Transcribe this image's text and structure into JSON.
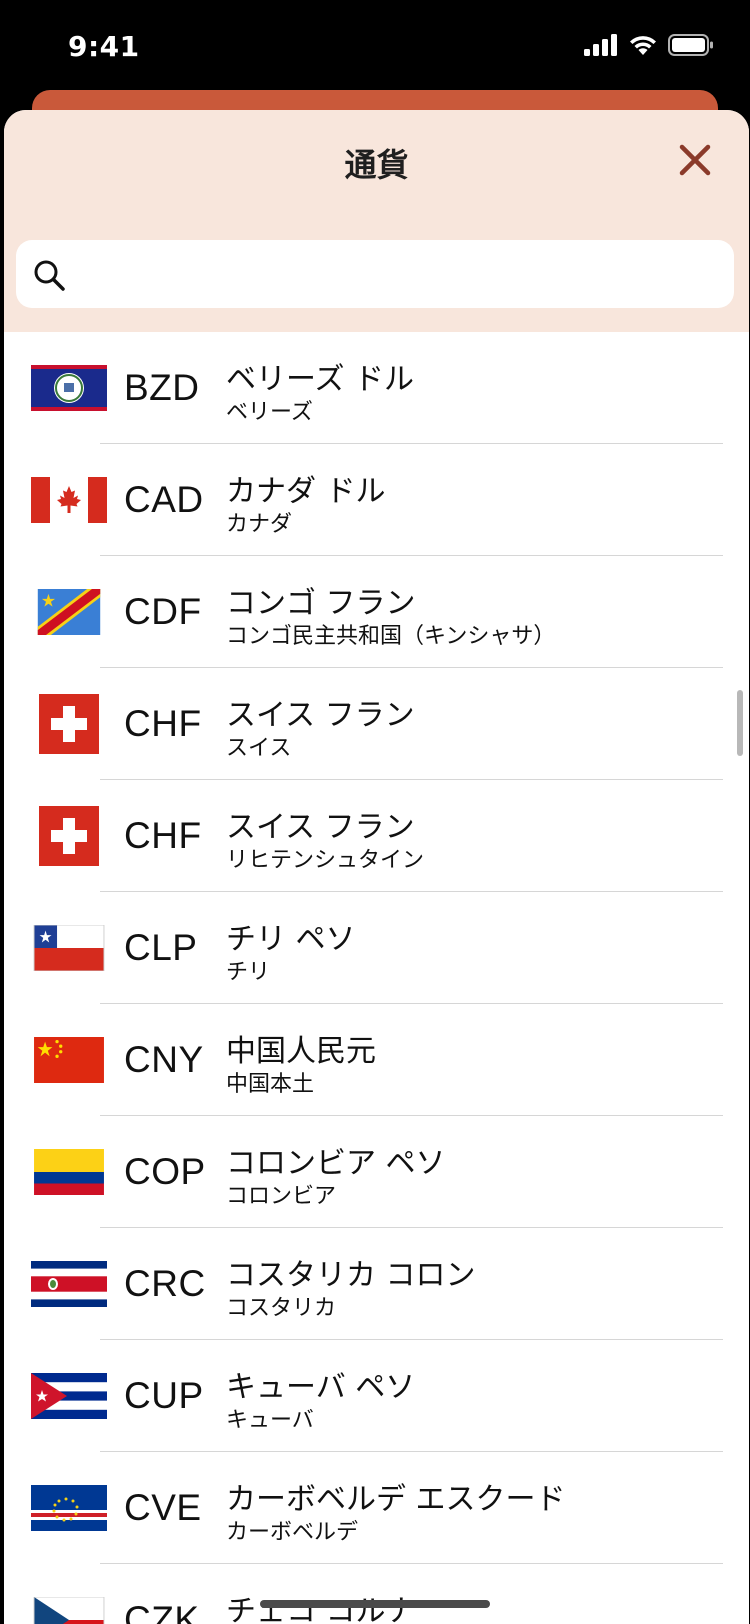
{
  "status_bar": {
    "time": "9:41",
    "icons": [
      "signal-icon",
      "wifi-icon",
      "battery-icon"
    ]
  },
  "sheet": {
    "title": "通貨",
    "close_icon": "close-icon",
    "search": {
      "placeholder": "",
      "value": ""
    }
  },
  "colors": {
    "accent": "#c9593a",
    "header_bg": "#f8e6dc",
    "close": "#8b3a2a"
  },
  "currencies": [
    {
      "code": "BZD",
      "name": "ベリーズ ドル",
      "region": "ベリーズ",
      "flag": "belize-flag"
    },
    {
      "code": "CAD",
      "name": "カナダ ドル",
      "region": "カナダ",
      "flag": "canada-flag"
    },
    {
      "code": "CDF",
      "name": "コンゴ フラン",
      "region": "コンゴ民主共和国（キンシャサ）",
      "flag": "dr-congo-flag"
    },
    {
      "code": "CHF",
      "name": "スイス フラン",
      "region": "スイス",
      "flag": "switzerland-flag"
    },
    {
      "code": "CHF",
      "name": "スイス フラン",
      "region": "リヒテンシュタイン",
      "flag": "switzerland-flag"
    },
    {
      "code": "CLP",
      "name": "チリ ペソ",
      "region": "チリ",
      "flag": "chile-flag"
    },
    {
      "code": "CNY",
      "name": "中国人民元",
      "region": "中国本土",
      "flag": "china-flag"
    },
    {
      "code": "COP",
      "name": "コロンビア ペソ",
      "region": "コロンビア",
      "flag": "colombia-flag"
    },
    {
      "code": "CRC",
      "name": "コスタリカ コロン",
      "region": "コスタリカ",
      "flag": "costa-rica-flag"
    },
    {
      "code": "CUP",
      "name": "キューバ ペソ",
      "region": "キューバ",
      "flag": "cuba-flag"
    },
    {
      "code": "CVE",
      "name": "カーボベルデ エスクード",
      "region": "カーボベルデ",
      "flag": "cape-verde-flag"
    },
    {
      "code": "CZK",
      "name": "チェコ コルナ",
      "region": "",
      "flag": "czech-flag"
    }
  ]
}
